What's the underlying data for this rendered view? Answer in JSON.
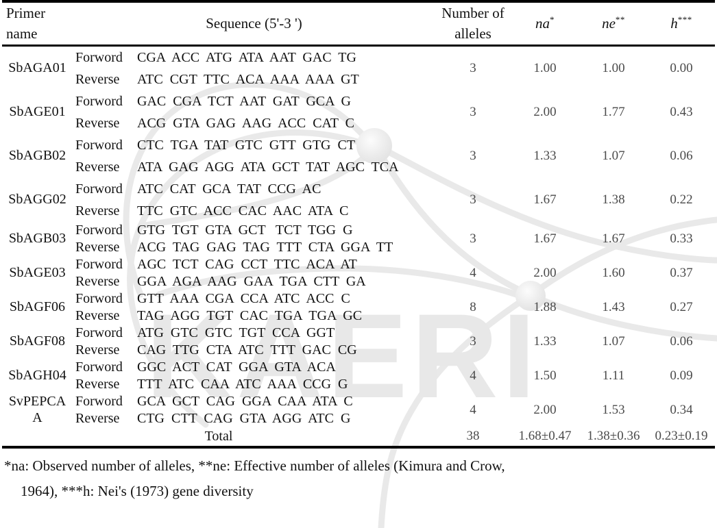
{
  "table": {
    "headers": {
      "primer_name": "Primer name",
      "primer_name_line1": "Primer",
      "primer_name_line2": "name",
      "sequence": "Sequence (5'-3 ')",
      "number_of_alleles_line1": "Number  of",
      "number_of_alleles_line2": "alleles",
      "na": "na",
      "na_sup": "*",
      "ne": "ne",
      "ne_sup": "**",
      "h": "h",
      "h_sup": "***"
    },
    "direction_labels": {
      "forward": "Forword",
      "reverse": "Reverse"
    },
    "rows": [
      {
        "name": "SbAGA01",
        "name_line2": "",
        "forward": "CGA  ACC  ATG  ATA  AAT  GAC  TG",
        "reverse": "ATC  CGT  TTC  ACA  AAA  AAA  GT",
        "number_of_alleles": "3",
        "na": "1.00",
        "ne": "1.00",
        "h": "0.00",
        "spacing": "wide"
      },
      {
        "name": "SbAGE01",
        "name_line2": "",
        "forward": "GAC  CGA  TCT  AAT  GAT  GCA  G",
        "reverse": "ACG  GTA  GAG  AAG  ACC  CAT  C",
        "number_of_alleles": "3",
        "na": "2.00",
        "ne": "1.77",
        "h": "0.43",
        "spacing": "wide"
      },
      {
        "name": "SbAGB02",
        "name_line2": "",
        "forward": "CTC  TGA  TAT  GTC  GTT  GTG  CT",
        "reverse": "ATA  GAG  AGG  ATA  GCT  TAT  AGC  TCA",
        "number_of_alleles": "3",
        "na": "1.33",
        "ne": "1.07",
        "h": "0.06",
        "spacing": "wide"
      },
      {
        "name": "SbAGG02",
        "name_line2": "",
        "forward": "ATC  CAT  GCA  TAT  CCG  AC",
        "reverse": "TTC  GTC  ACC  CAC  AAC  ATA  C",
        "number_of_alleles": "3",
        "na": "1.67",
        "ne": "1.38",
        "h": "0.22",
        "spacing": "wide"
      },
      {
        "name": "SbAGB03",
        "name_line2": "",
        "forward": "GTG  TGT  GTA  GCT   TCT  TGG  G",
        "reverse": "ACG  TAG  GAG  TAG  TTT  CTA  GGA  TT",
        "number_of_alleles": "3",
        "na": "1.67",
        "ne": "1.67",
        "h": "0.33",
        "spacing": "tight"
      },
      {
        "name": "SbAGE03",
        "name_line2": "",
        "forward": "AGC  TCT  CAG  CCT  TTC  ACA  AT",
        "reverse": "GGA  AGA  AAG  GAA  TGA  CTT  GA",
        "number_of_alleles": "4",
        "na": "2.00",
        "ne": "1.60",
        "h": "0.37",
        "spacing": "tight"
      },
      {
        "name": "SbAGF06",
        "name_line2": "",
        "forward": "GTT  AAA  CGA  CCA  ATC  ACC  C",
        "reverse": "TAG  AGG  TGT  CAC  TGA  TGA  GC",
        "number_of_alleles": "8",
        "na": "1.88",
        "ne": "1.43",
        "h": "0.27",
        "spacing": "tight"
      },
      {
        "name": "SbAGF08",
        "name_line2": "",
        "forward": "ATG  GTC  GTC  TGT  CCA  GGT",
        "reverse": "CAG  TTG  CTA  ATC  TTT  GAC  CG",
        "number_of_alleles": "3",
        "na": "1.33",
        "ne": "1.07",
        "h": "0.06",
        "spacing": "tight"
      },
      {
        "name": "SbAGH04",
        "name_line2": "",
        "forward": "GGC  ACT  CAT  GGA  GTA  ACA",
        "reverse": "TTT  ATC  CAA  ATC  AAA  CCG  G",
        "number_of_alleles": "4",
        "na": "1.50",
        "ne": "1.11",
        "h": "0.09",
        "spacing": "tight"
      },
      {
        "name": "SvPEPCA",
        "name_line2": "A",
        "forward": "GCA  GCT  CAG  GGA  CAA  ATA  C",
        "reverse": "CTG  CTT  CAG  GTA  AGG  ATC  G",
        "number_of_alleles": "4",
        "na": "2.00",
        "ne": "1.53",
        "h": "0.34",
        "spacing": "tight"
      }
    ],
    "total": {
      "label": "Total",
      "number_of_alleles": "38",
      "na": "1.68±0.47",
      "ne": "1.38±0.36",
      "h": "0.23±0.19"
    }
  },
  "footnote": {
    "line1": "*na: Observed  number  of  alleles,  **ne:  Effective  number  of  alleles  (Kimura  and  Crow,",
    "line2": "1964),   ***h: Nei's (1973) gene  diversity"
  },
  "watermark": {
    "text": "KAERI",
    "color": "#e8e8e8"
  }
}
